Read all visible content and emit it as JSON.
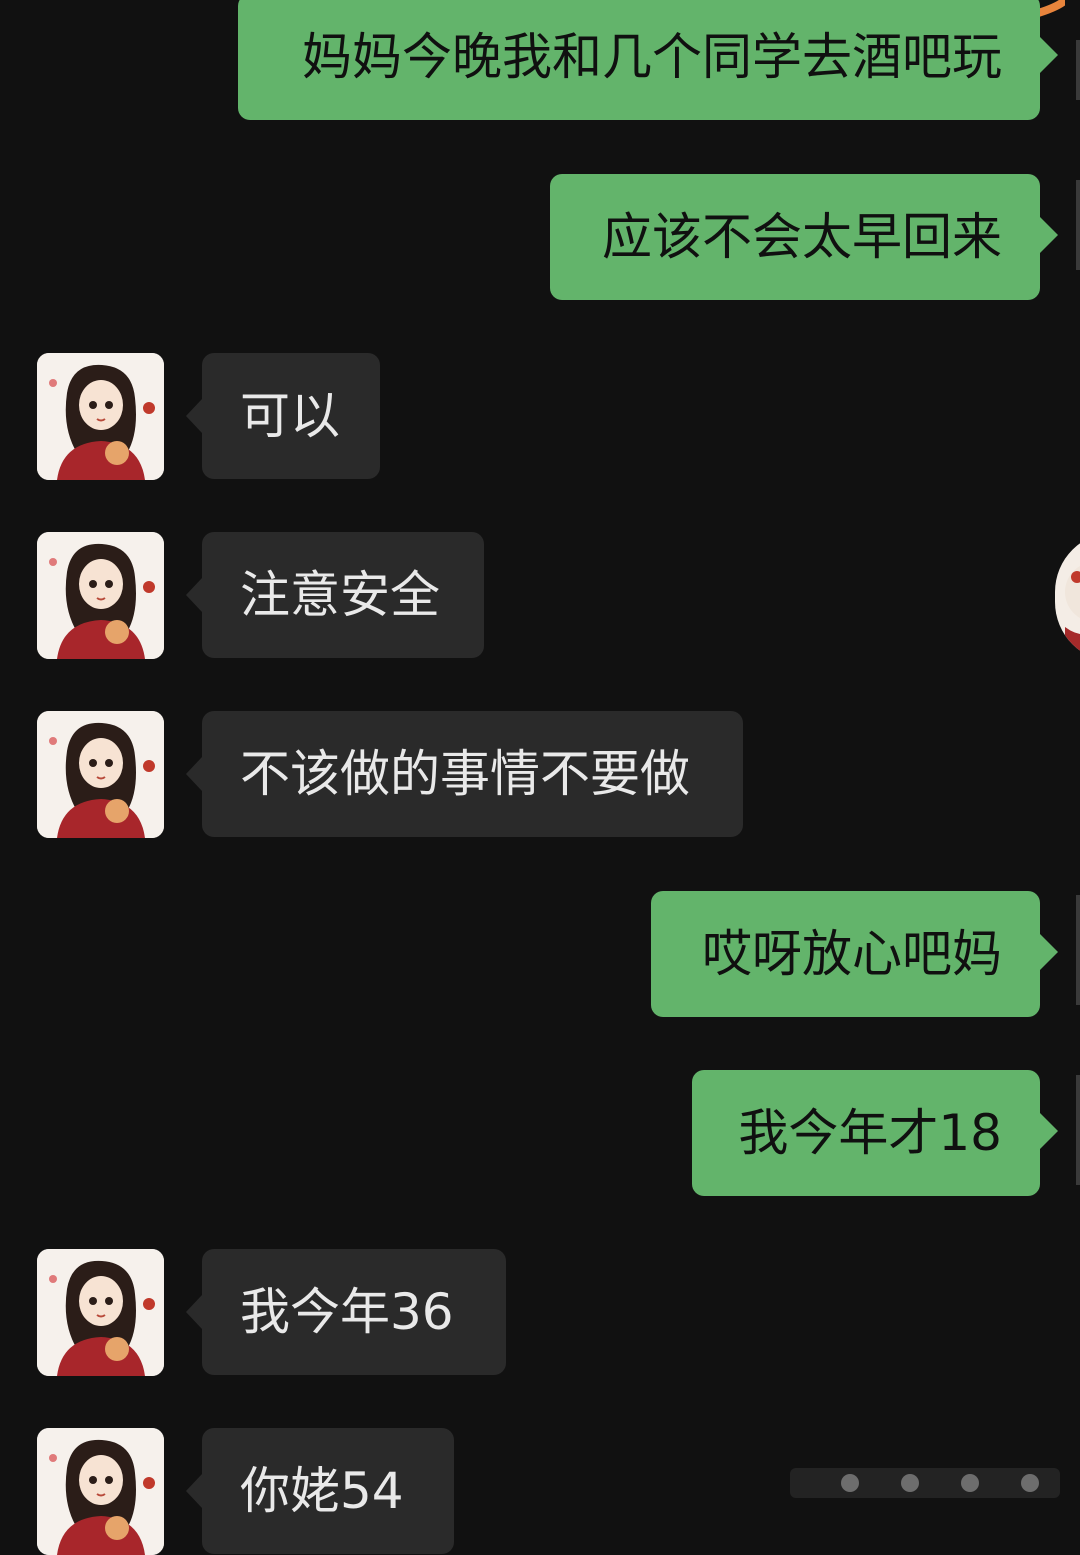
{
  "messages": [
    {
      "side": "out",
      "text": "妈妈今晚我和几个同学去酒吧玩"
    },
    {
      "side": "out",
      "text": "应该不会太早回来"
    },
    {
      "side": "in",
      "text": "可以"
    },
    {
      "side": "in",
      "text": "注意安全"
    },
    {
      "side": "in",
      "text": "不该做的事情不要做"
    },
    {
      "side": "out",
      "text": "哎呀放心吧妈"
    },
    {
      "side": "out",
      "text": "我今年才18"
    },
    {
      "side": "in",
      "text": "我今年36"
    },
    {
      "side": "in",
      "text": "你姥54"
    }
  ],
  "colors": {
    "background": "#111111",
    "outgoing_bubble": "#63b46b",
    "incoming_bubble": "#2a2a2a"
  }
}
